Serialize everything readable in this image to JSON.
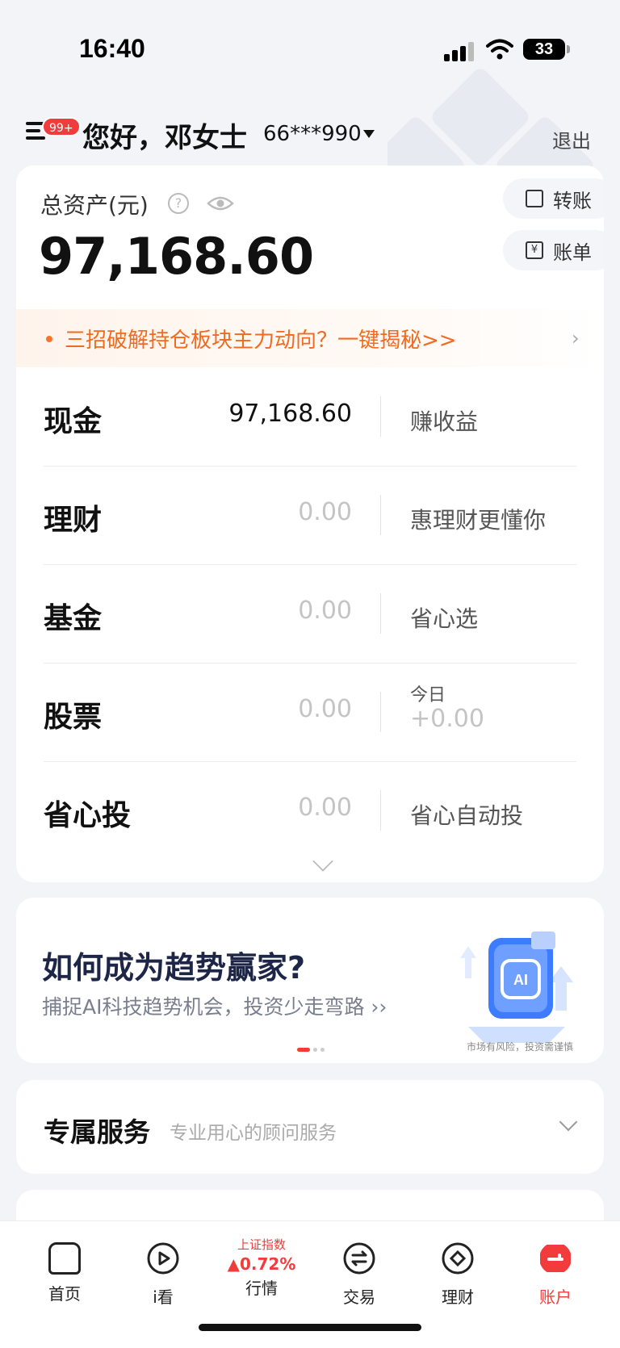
{
  "status_bar": {
    "time": "16:40",
    "battery": "33"
  },
  "header": {
    "badge": "99+",
    "greeting": "您好，邓女士",
    "account_no": "66***990",
    "logout": "退出"
  },
  "assets": {
    "total_label": "总资产(元)",
    "total_value": "97,168.60",
    "transfer": "转账",
    "bill": "账单",
    "promo": "三招破解持仓板块主力动向？一键揭秘>>",
    "rows": [
      {
        "label": "现金",
        "value": "97,168.60",
        "sub": "赚收益"
      },
      {
        "label": "理财",
        "value": "0.00",
        "sub": "惠理财更懂你"
      },
      {
        "label": "基金",
        "value": "0.00",
        "sub": "省心选"
      },
      {
        "label": "股票",
        "value": "0.00",
        "today_label": "今日",
        "today_value": "+0.00"
      },
      {
        "label": "省心投",
        "value": "0.00",
        "sub": "省心自动投"
      }
    ]
  },
  "banner": {
    "title": "如何成为趋势赢家?",
    "subtitle": "捕捉AI科技趋势机会，投资少走弯路 ››",
    "risk": "市场有风险，投资需谨慎",
    "art_text": "AI"
  },
  "service": {
    "title": "专属服务",
    "subtitle": "专业用心的顾问服务"
  },
  "tabbar": {
    "tabs": [
      "首页",
      "i看",
      "行情",
      "交易",
      "理财",
      "账户"
    ],
    "index_name": "上证指数",
    "index_change": "▲0.72%"
  },
  "colors": {
    "accent": "#f23b3b",
    "promo": "#f06a1f",
    "banner_title": "#1e2648"
  }
}
